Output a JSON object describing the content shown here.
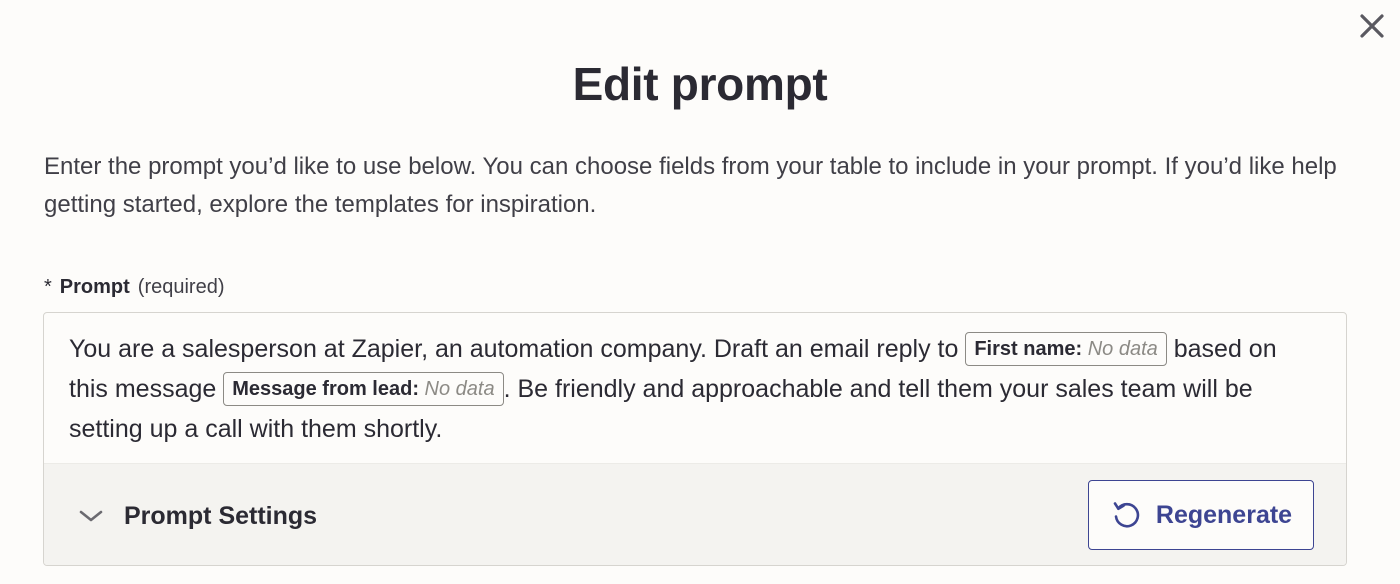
{
  "dialog": {
    "title": "Edit prompt",
    "description": "Enter the prompt you’d like to use below. You can choose fields from your table to include in your prompt. If you’d like help getting started, explore the templates for inspiration.",
    "close_icon": "close-icon"
  },
  "prompt_field": {
    "required_marker": "*",
    "label": "Prompt",
    "required_text": "(required)",
    "segments": {
      "text1": "You are a salesperson at Zapier, an automation company. Draft an email reply to ",
      "chip1_key": "First name:",
      "chip1_value": "No data",
      "text2": " based on this message ",
      "chip2_key": "Message from lead:",
      "chip2_value": "No data",
      "text3": ". Be friendly and approachable and tell them your sales team will be setting up a call with them shortly."
    }
  },
  "settings": {
    "label": "Prompt Settings",
    "icon": "chevron-down-icon"
  },
  "regenerate": {
    "label": "Regenerate",
    "icon": "rotate-ccw-icon"
  },
  "colors": {
    "background": "#fdfcfa",
    "text": "#2b2a33",
    "accent": "#3d4592",
    "settings_bar": "#f4f3f0"
  }
}
